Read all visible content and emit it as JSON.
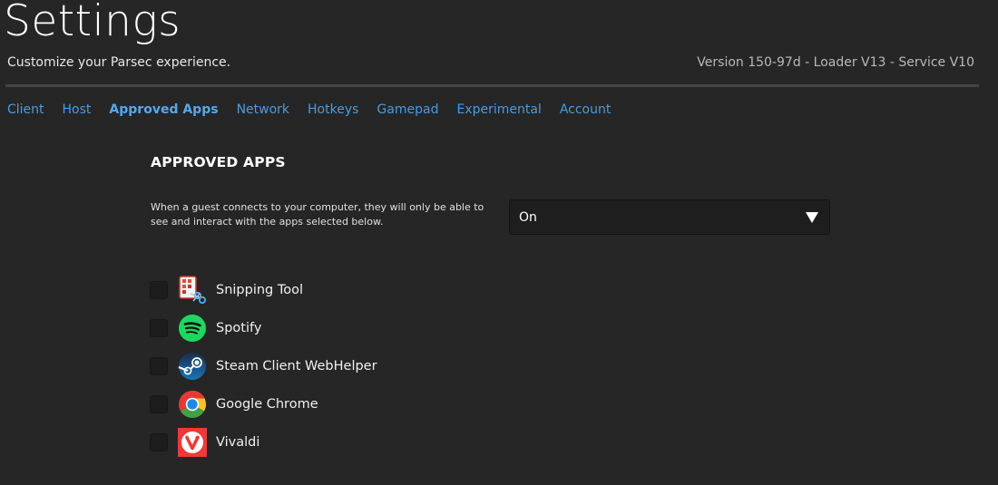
{
  "header": {
    "title": "Settings",
    "subtitle": "Customize your Parsec experience.",
    "version": "Version 150-97d - Loader V13 - Service V10"
  },
  "tabs": [
    {
      "label": "Client",
      "active": false
    },
    {
      "label": "Host",
      "active": false
    },
    {
      "label": "Approved Apps",
      "active": true
    },
    {
      "label": "Network",
      "active": false
    },
    {
      "label": "Hotkeys",
      "active": false
    },
    {
      "label": "Gamepad",
      "active": false
    },
    {
      "label": "Experimental",
      "active": false
    },
    {
      "label": "Account",
      "active": false
    }
  ],
  "section": {
    "title": "APPROVED APPS",
    "description": "When a guest connects to your computer, they will only be able to see and interact with the apps selected below.",
    "select_value": "On"
  },
  "apps": [
    {
      "label": "Snipping Tool",
      "icon": "snipping-tool-icon",
      "checked": false
    },
    {
      "label": "Spotify",
      "icon": "spotify-icon",
      "checked": false
    },
    {
      "label": "Steam Client WebHelper",
      "icon": "steam-icon",
      "checked": false
    },
    {
      "label": "Google Chrome",
      "icon": "chrome-icon",
      "checked": false
    },
    {
      "label": "Vivaldi",
      "icon": "vivaldi-icon",
      "checked": false
    }
  ],
  "colors": {
    "background": "#262626",
    "tab_link": "#4a9be0",
    "divider": "#444444",
    "spotify_green": "#1ed760",
    "vivaldi_red": "#ef3939"
  }
}
